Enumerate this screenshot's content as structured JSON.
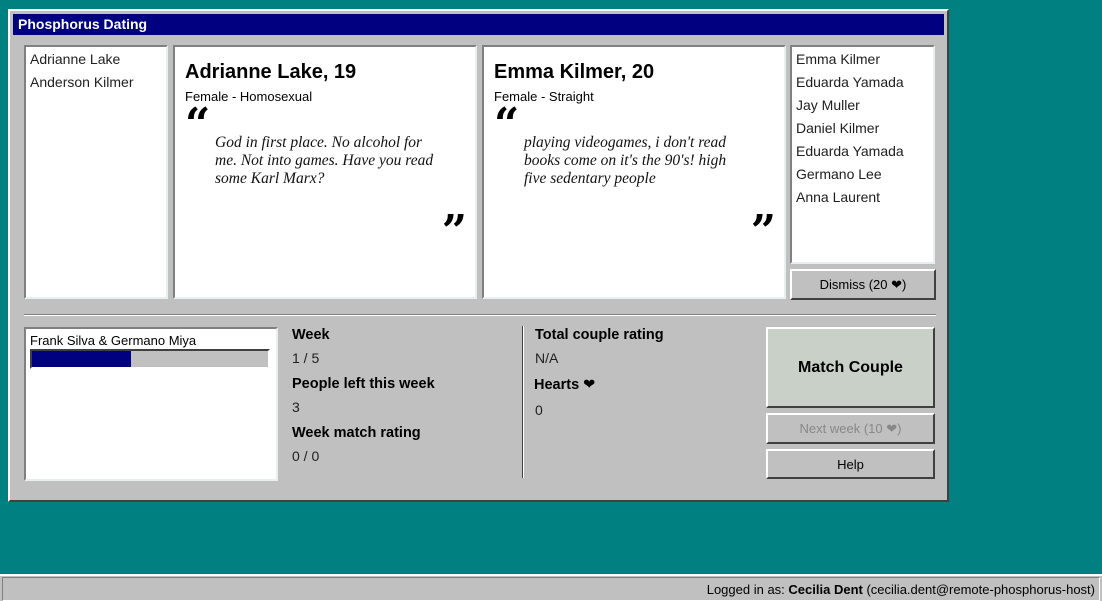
{
  "window": {
    "title": "Phosphorus Dating"
  },
  "left_list": {
    "items": [
      "Adrianne Lake",
      "Anderson Kilmer"
    ]
  },
  "right_list": {
    "items": [
      "Emma Kilmer",
      "Eduarda Yamada",
      "Jay Muller",
      "Daniel Kilmer",
      "Eduarda Yamada",
      "Germano Lee",
      "Anna Laurent"
    ]
  },
  "profile_left": {
    "name": "Adrianne Lake, 19",
    "subtitle": "Female - Homosexual",
    "quote": "God in first place. No alcohol for me. Not into games. Have you read some Karl Marx?"
  },
  "profile_right": {
    "name": "Emma Kilmer, 20",
    "subtitle": "Female - Straight",
    "quote": "playing videogames, i don't read books come on it's the 90's! high five sedentary people"
  },
  "quote_marks": {
    "open": "“",
    "close": "”"
  },
  "dismiss_button": {
    "label": "Dismiss (20 ❤)"
  },
  "couples_list": {
    "items": [
      {
        "label": "Frank Silva & Germano Miya",
        "progress": 0.42
      }
    ]
  },
  "stats": {
    "week_label": "Week",
    "week_value": "1 / 5",
    "people_left_label": "People left this week",
    "people_left_value": "3",
    "week_match_label": "Week match rating",
    "week_match_value": "0 / 0",
    "total_rating_label": "Total couple rating",
    "total_rating_value": "N/A",
    "hearts_label": "Hearts ❤",
    "hearts_value": "0"
  },
  "buttons": {
    "match": "Match Couple",
    "next_week": "Next week (10 ❤)",
    "help": "Help"
  },
  "statusbar": {
    "prefix": "Logged in as:",
    "user": "Cecilia Dent",
    "host": "(cecilia.dent@remote-phosphorus-host)"
  },
  "colors": {
    "desktop": "#008080",
    "titlebar": "#000080",
    "progress": "#000080"
  }
}
